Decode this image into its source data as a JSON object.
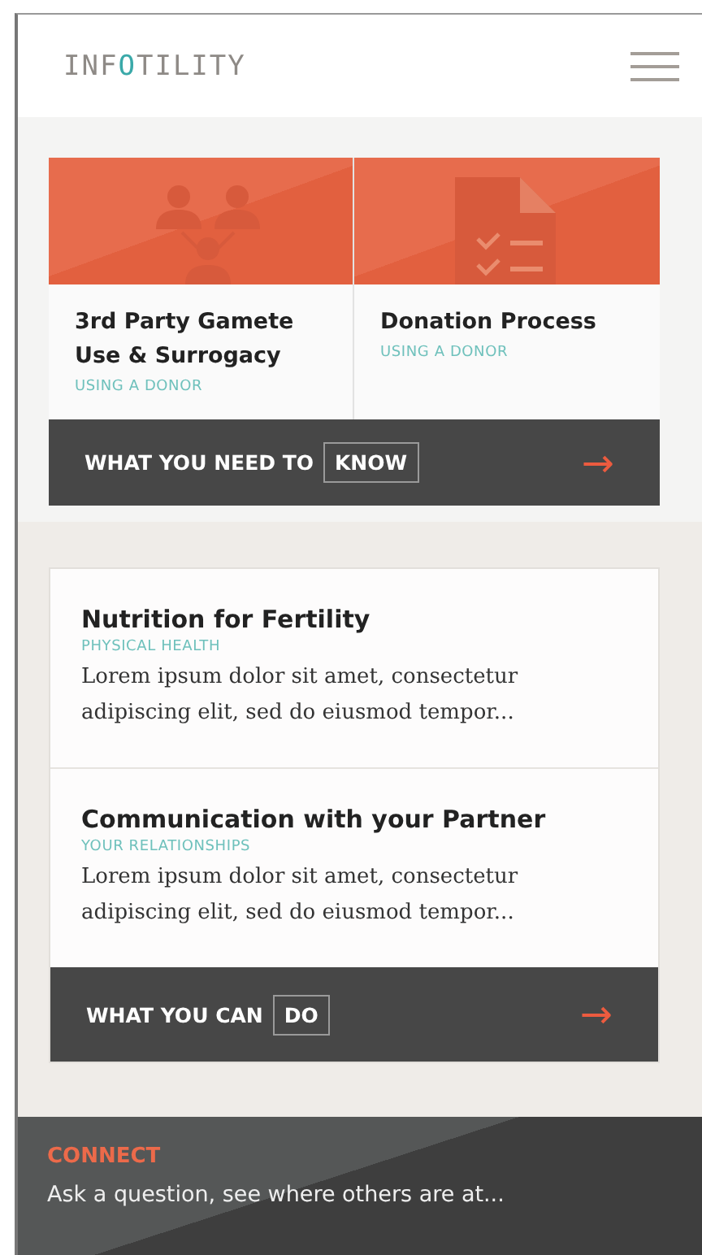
{
  "header": {
    "logo": [
      "INF",
      "O",
      "TILITY"
    ]
  },
  "know_section": {
    "cards": [
      {
        "kind": "people",
        "title": "3rd Party Gamete Use & Surrogacy",
        "category": "USING A DONOR"
      },
      {
        "kind": "checklist",
        "title": "Donation Process",
        "category": "USING A DONOR"
      }
    ],
    "footer": {
      "label": "WHAT YOU NEED TO",
      "boxed": "KNOW",
      "arrow": "→"
    }
  },
  "do_section": {
    "articles": [
      {
        "title": "Nutrition for Fertility",
        "category": "PHYSICAL HEALTH",
        "excerpt": "Lorem ipsum dolor sit amet, consectetur adipiscing elit, sed do eiusmod tempor..."
      },
      {
        "title": "Communication with your Partner",
        "category": "YOUR RELATIONSHIPS",
        "excerpt": "Lorem ipsum dolor sit amet, consectetur adipiscing elit, sed do eiusmod tempor..."
      }
    ],
    "footer": {
      "label": "WHAT YOU CAN",
      "boxed": "DO",
      "arrow": "→"
    }
  },
  "connect": {
    "title": "CONNECT",
    "text": "Ask a question, see where others are at..."
  }
}
